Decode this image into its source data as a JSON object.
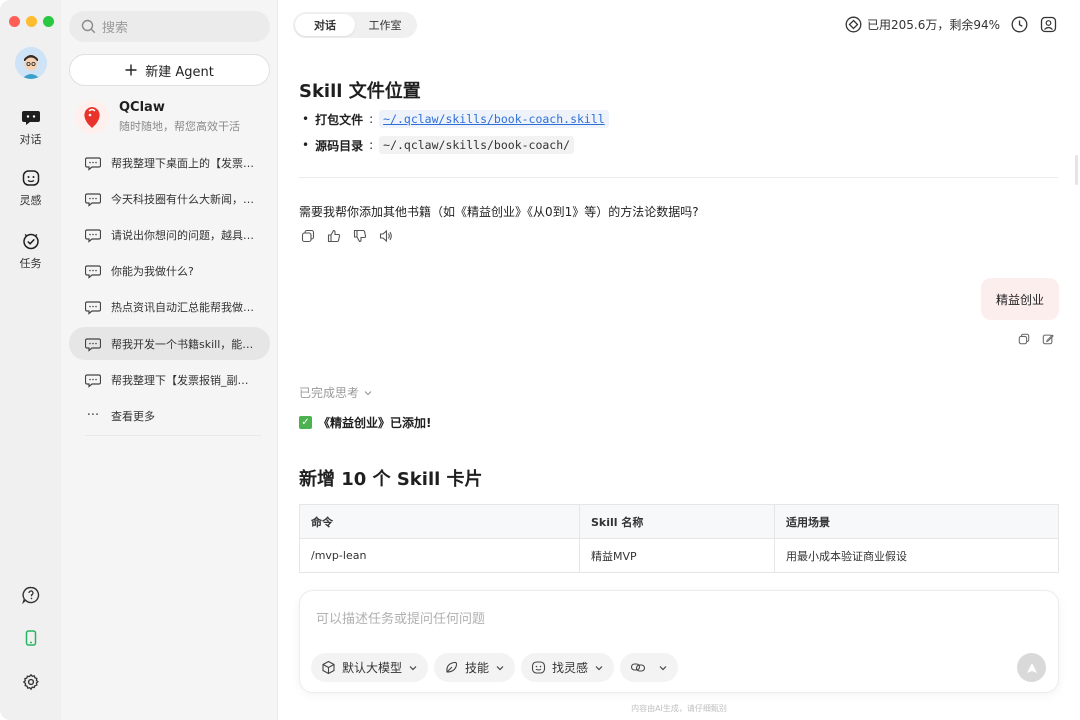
{
  "window": {
    "traffic_colors": [
      "#ff5f57",
      "#febc2e",
      "#28c840"
    ]
  },
  "rail": {
    "items": [
      {
        "label": "对话",
        "icon": "chat-bubble-icon"
      },
      {
        "label": "灵感",
        "icon": "sparkle-face-icon"
      },
      {
        "label": "任务",
        "icon": "check-circle-icon"
      }
    ],
    "bottom_icons": [
      "help-icon",
      "phone-icon",
      "gear-icon"
    ]
  },
  "sidebar": {
    "search_placeholder": "搜索",
    "new_agent_label": "新建 Agent",
    "agent": {
      "name": "QClaw",
      "subtitle": "随时随地，帮您高效干活"
    },
    "conversations": [
      "帮我整理下桌面上的【发票…",
      "今天科技圈有什么大新闻，…",
      "请说出你想问的问题，越具…",
      "你能为我做什么?",
      "热点资讯自动汇总能帮我做…",
      "帮我开发一个书籍skill，能…",
      "帮我整理下【发票报销_副…"
    ],
    "active_index": 5,
    "more_label": "查看更多"
  },
  "header": {
    "tabs": [
      "对话",
      "工作室"
    ],
    "quota_text": "已用205.6万，剩余94%"
  },
  "chat": {
    "section_title": "Skill 文件位置",
    "bullets": [
      {
        "label": "打包文件",
        "sep": ": ",
        "path": "~/.qclaw/skills/book-coach.skill"
      },
      {
        "label": "源码目录",
        "sep": ": ",
        "path": "~/.qclaw/skills/book-coach/"
      }
    ],
    "question": "需要我帮你添加其他书籍（如《精益创业》《从0到1》等）的方法论数据吗?",
    "user_message": "精益创业",
    "thinking_label": "已完成思考",
    "done_text": "《精益创业》已添加!",
    "cards_title": "新增 10 个 Skill 卡片",
    "table": {
      "headers": [
        "命令",
        "Skill 名称",
        "适用场景"
      ],
      "rows": [
        [
          "/mvp-lean",
          "精益MVP",
          "用最小成本验证商业假设"
        ]
      ]
    }
  },
  "composer": {
    "placeholder": "可以描述任务或提问任何问题",
    "chips": [
      "默认大模型",
      "技能",
      "找灵感"
    ]
  },
  "footer_note": "内容由AI生成，请仔细甄别"
}
